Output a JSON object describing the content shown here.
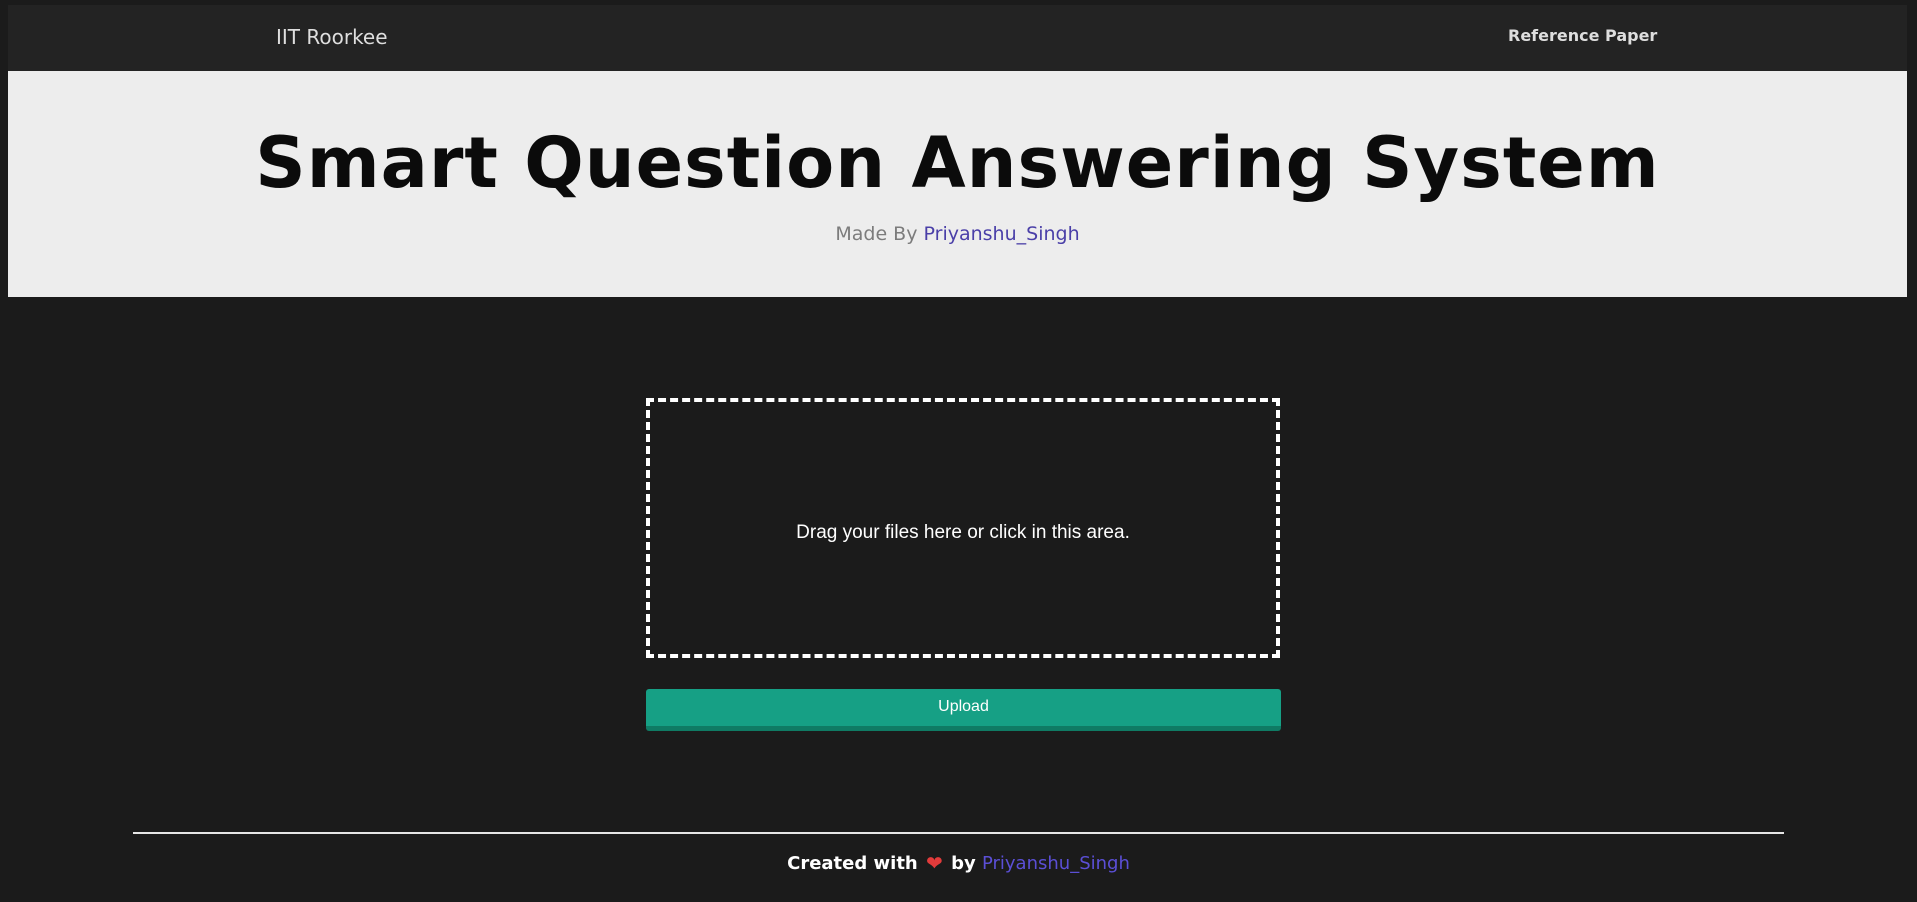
{
  "navbar": {
    "brand": "IIT Roorkee",
    "link": "Reference Paper"
  },
  "hero": {
    "title": "Smart Question Answering System",
    "made_by_prefix": "Made By",
    "author": "Priyanshu_Singh"
  },
  "upload": {
    "dropzone_text": "Drag your files here or click in this area.",
    "button_label": "Upload"
  },
  "footer": {
    "prefix": "Created with",
    "heart": "❤",
    "middle": "by",
    "author": "Priyanshu_Singh"
  },
  "colors": {
    "background": "#1b1b1b",
    "navbar": "#232323",
    "hero": "#ededed",
    "accent": "#16a085",
    "link": "#4a3fa8",
    "heart": "#e23b3b"
  }
}
